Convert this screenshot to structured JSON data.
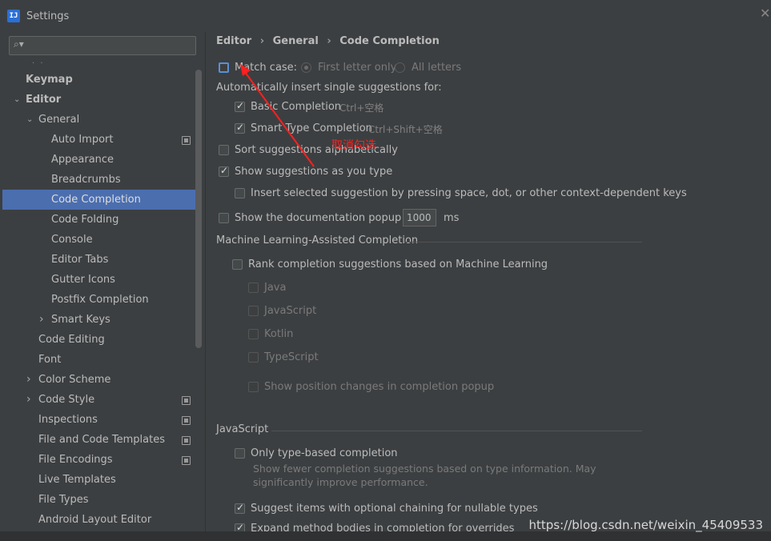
{
  "window": {
    "title": "Settings",
    "app_icon": "IJ"
  },
  "search": {
    "placeholder": "",
    "value": ""
  },
  "sidebar": {
    "dots": "· ·",
    "items": [
      {
        "label": "Keymap",
        "level": 0,
        "bold": true
      },
      {
        "label": "Editor",
        "level": 0,
        "bold": true,
        "expanded": true
      },
      {
        "label": "General",
        "level": 1,
        "expanded": true
      },
      {
        "label": "Auto Import",
        "level": 2,
        "project": true
      },
      {
        "label": "Appearance",
        "level": 2
      },
      {
        "label": "Breadcrumbs",
        "level": 2
      },
      {
        "label": "Code Completion",
        "level": 2,
        "selected": true
      },
      {
        "label": "Code Folding",
        "level": 2
      },
      {
        "label": "Console",
        "level": 2
      },
      {
        "label": "Editor Tabs",
        "level": 2
      },
      {
        "label": "Gutter Icons",
        "level": 2
      },
      {
        "label": "Postfix Completion",
        "level": 2
      },
      {
        "label": "Smart Keys",
        "level": 2,
        "collapsed": true
      },
      {
        "label": "Code Editing",
        "level": 1
      },
      {
        "label": "Font",
        "level": 1
      },
      {
        "label": "Color Scheme",
        "level": 1,
        "collapsed": true
      },
      {
        "label": "Code Style",
        "level": 1,
        "collapsed": true,
        "project": true
      },
      {
        "label": "Inspections",
        "level": 1,
        "project": true
      },
      {
        "label": "File and Code Templates",
        "level": 1,
        "project": true
      },
      {
        "label": "File Encodings",
        "level": 1,
        "project": true
      },
      {
        "label": "Live Templates",
        "level": 1
      },
      {
        "label": "File Types",
        "level": 1
      },
      {
        "label": "Android Layout Editor",
        "level": 1
      }
    ]
  },
  "breadcrumb": [
    "Editor",
    "General",
    "Code Completion"
  ],
  "breadcrumb_sep": "›",
  "options": {
    "match_case": {
      "label": "Match case:",
      "checked": false
    },
    "first_letter_only": {
      "label": "First letter only",
      "selected": true
    },
    "all_letters": {
      "label": "All letters",
      "selected": false
    },
    "auto_insert_heading": "Automatically insert single suggestions for:",
    "basic_completion": {
      "label": "Basic Completion",
      "shortcut": "Ctrl+空格",
      "checked": true
    },
    "smart_type_completion": {
      "label": "Smart Type Completion",
      "shortcut": "Ctrl+Shift+空格",
      "checked": true
    },
    "sort_alphabetically": {
      "label": "Sort suggestions alphabetically",
      "checked": false
    },
    "show_as_you_type": {
      "label": "Show suggestions as you type",
      "checked": true
    },
    "insert_selected": {
      "label": "Insert selected suggestion by pressing space, dot, or other context-dependent keys",
      "checked": false
    },
    "show_doc_popup": {
      "label": "Show the documentation popup in",
      "value": "1000",
      "unit": "ms",
      "checked": false
    }
  },
  "ml_section": {
    "title": "Machine Learning-Assisted Completion",
    "rank": {
      "label": "Rank completion suggestions based on Machine Learning",
      "checked": false
    },
    "languages": [
      "Java",
      "JavaScript",
      "Kotlin",
      "TypeScript"
    ],
    "show_position": "Show position changes in completion popup"
  },
  "js_section": {
    "title": "JavaScript",
    "only_type_based": {
      "label": "Only type-based completion",
      "checked": false
    },
    "only_type_based_desc1": "Show fewer completion suggestions based on type information. May",
    "only_type_based_desc2": "significantly improve performance.",
    "suggest_optional_chaining": {
      "label": "Suggest items with optional chaining for nullable types",
      "checked": true
    },
    "expand_method_bodies": {
      "label": "Expand method bodies in completion for overrides",
      "checked": true
    }
  },
  "annotation": {
    "text": "取消勾选",
    "color": "#ff2020"
  },
  "watermark": "https://blog.csdn.net/weixin_45409533",
  "colors": {
    "background": "#3c3f41",
    "selection": "#4b6eaf",
    "text": "#bbbbbb",
    "annotation": "#ff2020"
  }
}
